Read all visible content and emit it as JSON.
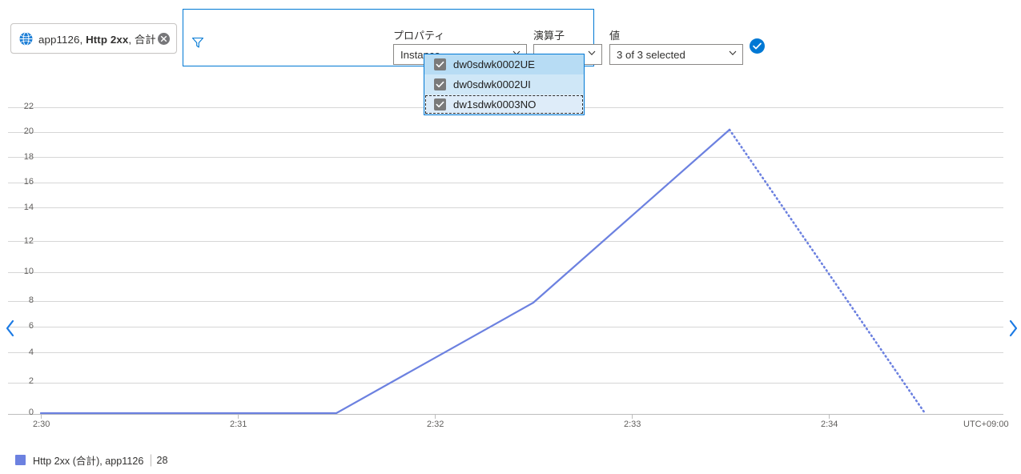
{
  "metric_chip": {
    "icon": "web-app-globe-icon",
    "resource": "app1126,",
    "metric": "Http 2xx",
    "aggregation": ", 合計",
    "close_icon": "close-icon"
  },
  "filter_panel": {
    "funnel_icon": "funnel-icon",
    "property": {
      "label": "プロパティ",
      "value": "Instance"
    },
    "operator": {
      "label": "演算子",
      "value": "="
    },
    "value": {
      "label": "値",
      "value": "3 of 3 selected"
    },
    "confirm_icon": "check-circle-icon",
    "options": [
      {
        "label": "dw0sdwk0002UE",
        "checked": true
      },
      {
        "label": "dw0sdwk0002UI",
        "checked": true
      },
      {
        "label": "dw1sdwk0003NO",
        "checked": true
      }
    ]
  },
  "nav": {
    "prev_icon": "chevron-left-icon",
    "next_icon": "chevron-right-icon"
  },
  "legend": {
    "swatch_color": "#6c81e0",
    "label": "Http 2xx (合計), app1126",
    "separator": "|",
    "value": "28"
  },
  "chart_data": {
    "type": "line",
    "title": "",
    "xlabel": "",
    "ylabel": "",
    "timezone_label": "UTC+09:00",
    "grid": true,
    "legend_position": "bottom-left",
    "ylim": [
      0,
      22
    ],
    "yticks": [
      0,
      2,
      4,
      6,
      8,
      10,
      12,
      14,
      16,
      18,
      20,
      22
    ],
    "xticks": [
      "2:30",
      "2:31",
      "2:32",
      "2:33",
      "2:34"
    ],
    "series": [
      {
        "name": "Http 2xx (合計), app1126",
        "color": "#6c81e0",
        "solid_points": [
          {
            "x": "2:30",
            "y": 0
          },
          {
            "x": "2:31.5",
            "y": 0
          },
          {
            "x": "2:32.5",
            "y": 8
          },
          {
            "x": "2:33.5",
            "y": 20
          }
        ],
        "dashed_points": [
          {
            "x": "2:33.5",
            "y": 20
          },
          {
            "x": "2:34.5",
            "y": 0
          }
        ]
      }
    ]
  }
}
